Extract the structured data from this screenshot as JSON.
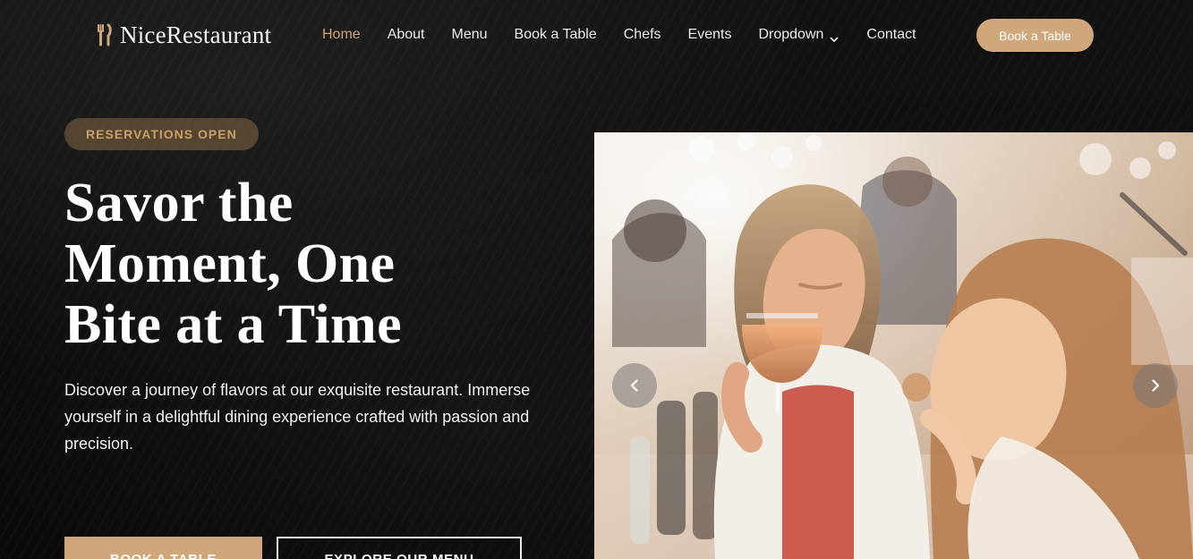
{
  "header": {
    "brand": "NiceRestaurant",
    "nav": [
      {
        "label": "Home"
      },
      {
        "label": "About"
      },
      {
        "label": "Menu"
      },
      {
        "label": "Book a Table"
      },
      {
        "label": "Chefs"
      },
      {
        "label": "Events"
      },
      {
        "label": "Dropdown"
      },
      {
        "label": "Contact"
      }
    ],
    "cta_label": "Book a Table",
    "active_nav": "Home",
    "dropdown_icon": "chevron-down-icon",
    "logo_icon": "utensils-icon"
  },
  "hero": {
    "badge": "RESERVATIONS OPEN",
    "title_lines": [
      "Savor the",
      "Moment, One",
      "Bite at a Time"
    ],
    "description": "Discover a journey of flavors at our exquisite restaurant. Immerse yourself in a delightful dining experience crafted with passion and precision.",
    "buttons": {
      "primary": "BOOK A TABLE",
      "secondary": "EXPLORE OUR MENU"
    },
    "carousel": {
      "prev_icon": "chevron-left-icon",
      "next_icon": "chevron-right-icon"
    }
  },
  "colors": {
    "accent": "#cfa77a",
    "accent_text": "#cda571",
    "badge_bg": "#856743",
    "background": "#0b0b0b",
    "text": "#ffffff"
  }
}
